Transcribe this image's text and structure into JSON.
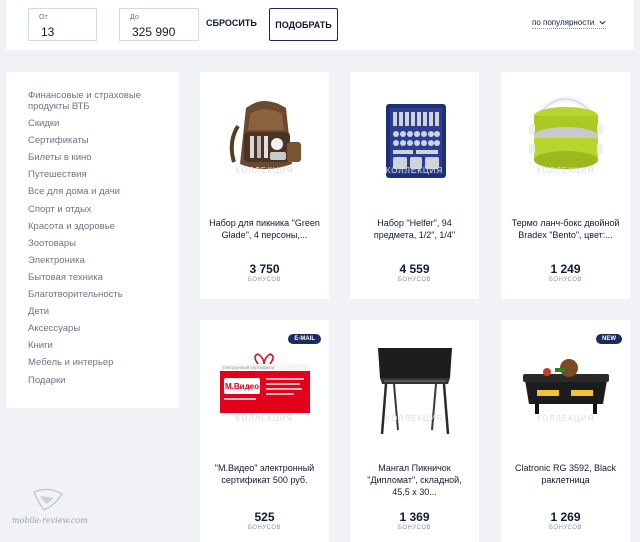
{
  "filters": {
    "from_label": "От",
    "from_value": "13",
    "to_label": "До",
    "to_value": "325 990",
    "reset_label": "СБРОСИТЬ",
    "apply_label": "ПОДОБРАТЬ",
    "sort_label": "по популярности"
  },
  "sidebar": {
    "items": [
      "Финансовые и страховые продукты ВТБ",
      "Скидки",
      "Сертификаты",
      "Билеты в кино",
      "Путешествия",
      "Все для дома и дачи",
      "Спорт и отдых",
      "Красота и здоровье",
      "Зоотовары",
      "Электроника",
      "Бытовая техника",
      "Благотворительность",
      "Дети",
      "Аксессуары",
      "Книги",
      "Мебель и интерьер",
      "Подарки"
    ]
  },
  "products": [
    {
      "title": "Набор для пикника \"Green Glade\", 4 персоны,...",
      "price": "3 750",
      "unit": "БОНУСОВ",
      "badge": "",
      "watermark": "КОЛЛЕКЦИЯ",
      "icon": "picnic-backpack-icon"
    },
    {
      "title": "Набор \"Helfer\", 94 предмета, 1/2\", 1/4\"",
      "price": "4 559",
      "unit": "БОНУСОВ",
      "badge": "",
      "watermark": "КОЛЛЕКЦИЯ",
      "icon": "toolbox-icon"
    },
    {
      "title": "Термо ланч-бокс двойной Bradex \"Bento\", цвет:...",
      "price": "1 249",
      "unit": "БОНУСОВ",
      "badge": "",
      "watermark": "КОЛЛЕКЦИЯ",
      "icon": "lunchbox-icon"
    },
    {
      "title": "\"М.Видео\" электронный сертификат 500 руб.",
      "price": "525",
      "unit": "БОНУСОВ",
      "badge": "E-MAIL",
      "watermark": "КОЛЛЕКЦИЯ",
      "icon": "gift-certificate-icon",
      "cert_logo": "М.Видео",
      "cert_caption": "электронный сертификат"
    },
    {
      "title": "Мангал Пикничок \"Дипломат\", складной, 45,5 х 30...",
      "price": "1 369",
      "unit": "БОНУСОВ",
      "badge": "",
      "watermark": "КОЛЛЕКЦИЯ",
      "icon": "grill-icon"
    },
    {
      "title": "Clatronic RG 3592, Black раклетница",
      "price": "1 269",
      "unit": "БОНУСОВ",
      "badge": "NEW",
      "watermark": "КОЛЛЕКЦИЯ",
      "icon": "raclette-grill-icon"
    }
  ],
  "site_watermark": "mobile-review.com",
  "colors": {
    "accent": "#1a2a63",
    "background": "#f0f2f6",
    "cert_red": "#e2001a",
    "lime": "#b5d62a"
  }
}
